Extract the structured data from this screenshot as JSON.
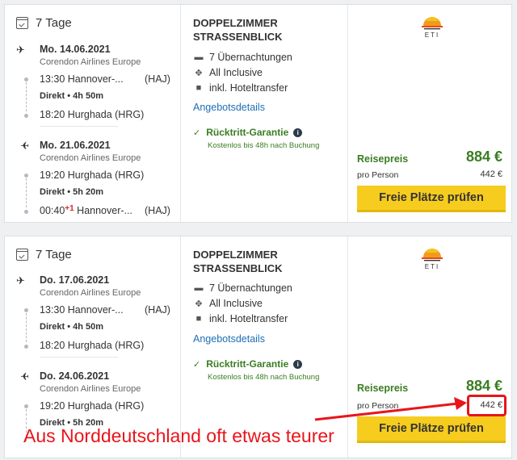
{
  "offers": [
    {
      "duration": "7 Tage",
      "outbound": {
        "date": "Mo. 14.06.2021",
        "airline": "Corendon Airlines Europe",
        "dep_time": "13:30",
        "dep_place": "Hannover-...",
        "dep_code": "(HAJ)",
        "direct": "Direkt",
        "flight_time": "4h 50m",
        "arr_time": "18:20",
        "arr_place": "Hurghada (HRG)",
        "arr_plus": ""
      },
      "inbound": {
        "date": "Mo. 21.06.2021",
        "airline": "Corendon Airlines Europe",
        "dep_time": "19:20",
        "dep_place": "Hurghada (HRG)",
        "dep_code": "",
        "direct": "Direkt",
        "flight_time": "5h 20m",
        "arr_time": "00:40",
        "arr_plus": "+1",
        "arr_place": "Hannover-...",
        "arr_code": "(HAJ)"
      },
      "room": "DOPPELZIMMER STRASSENBLICK",
      "features": [
        "7 Übernachtungen",
        "All Inclusive",
        "inkl. Hoteltransfer"
      ],
      "details_link": "Angebotsdetails",
      "guarantee": "Rücktritt-Garantie",
      "guarantee_sub": "Kostenlos bis 48h nach Buchung",
      "logo_text": "ETI",
      "price_label": "Reisepreis",
      "price": "884 €",
      "pp_label": "pro Person",
      "pp_price": "442 €",
      "button": "Freie Plätze prüfen"
    },
    {
      "duration": "7 Tage",
      "outbound": {
        "date": "Do. 17.06.2021",
        "airline": "Corendon Airlines Europe",
        "dep_time": "13:30",
        "dep_place": "Hannover-...",
        "dep_code": "(HAJ)",
        "direct": "Direkt",
        "flight_time": "4h 50m",
        "arr_time": "18:20",
        "arr_place": "Hurghada (HRG)",
        "arr_plus": ""
      },
      "inbound": {
        "date": "Do. 24.06.2021",
        "airline": "Corendon Airlines Europe",
        "dep_time": "19:20",
        "dep_place": "Hurghada (HRG)",
        "dep_code": "",
        "direct": "Direkt",
        "flight_time": "5h 20m",
        "arr_time": "",
        "arr_plus": "",
        "arr_place": "",
        "arr_code": ""
      },
      "room": "DOPPELZIMMER STRASSENBLICK",
      "features": [
        "7 Übernachtungen",
        "All Inclusive",
        "inkl. Hoteltransfer"
      ],
      "details_link": "Angebotsdetails",
      "guarantee": "Rücktritt-Garantie",
      "guarantee_sub": "Kostenlos bis 48h nach Buchung",
      "logo_text": "ETI",
      "price_label": "Reisepreis",
      "price": "884 €",
      "pp_label": "pro Person",
      "pp_price": "442 €",
      "button": "Freie Plätze prüfen"
    }
  ],
  "annotation": "Aus Norddeutschland oft etwas teurer",
  "colors": {
    "accent_green": "#3a7d22",
    "button_yellow": "#f6cc1e",
    "link_blue": "#1f6fb5",
    "annotation_red": "#e8151b"
  },
  "icons": [
    "calendar-icon",
    "plane-departure-icon",
    "plane-arrival-icon",
    "bed-icon",
    "restaurant-icon",
    "bus-icon",
    "check-icon",
    "info-icon",
    "sun-logo-icon"
  ]
}
